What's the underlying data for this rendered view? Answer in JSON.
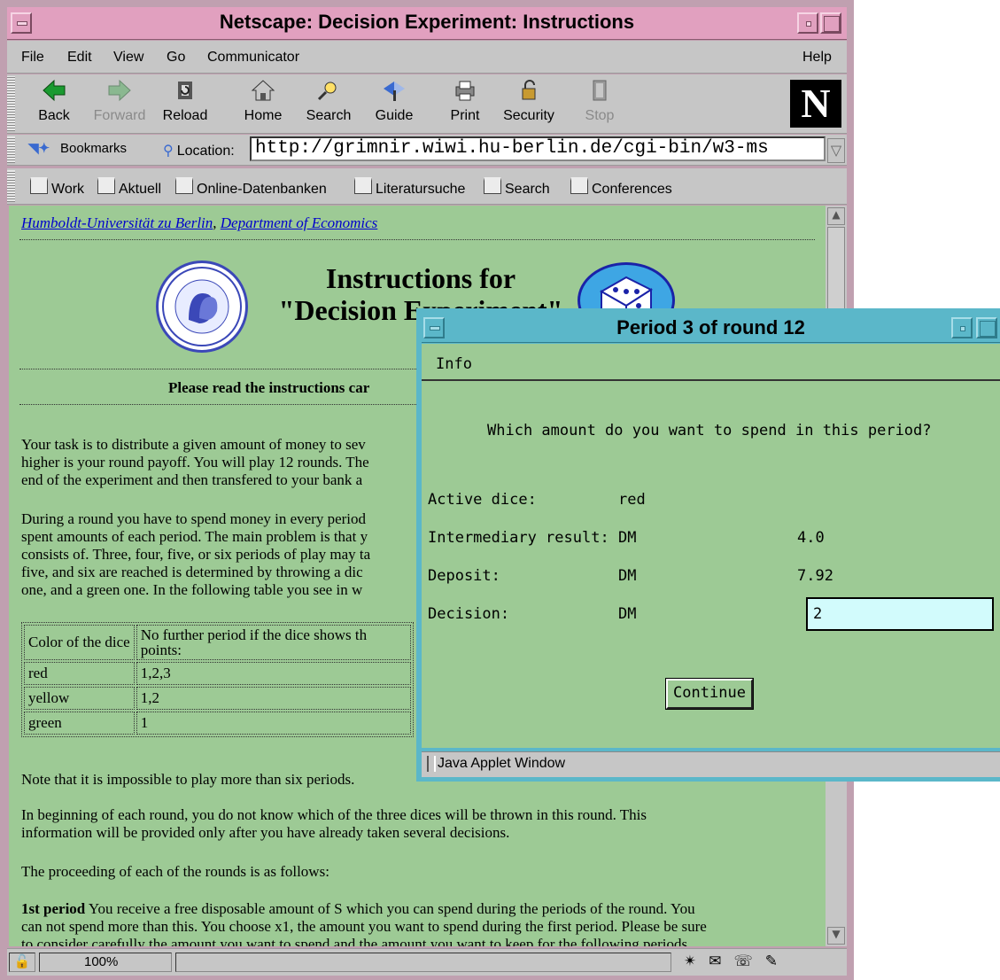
{
  "browser": {
    "title": "Netscape: Decision Experiment: Instructions",
    "menu": [
      "File",
      "Edit",
      "View",
      "Go",
      "Communicator"
    ],
    "help": "Help",
    "toolbar": [
      {
        "label": "Back",
        "icon": "back-arrow-icon",
        "enabled": true
      },
      {
        "label": "Forward",
        "icon": "forward-arrow-icon",
        "enabled": false
      },
      {
        "label": "Reload",
        "icon": "reload-icon",
        "enabled": true
      },
      {
        "label": "Home",
        "icon": "home-icon",
        "enabled": true
      },
      {
        "label": "Search",
        "icon": "search-icon",
        "enabled": true
      },
      {
        "label": "Guide",
        "icon": "guide-icon",
        "enabled": true
      },
      {
        "label": "Print",
        "icon": "print-icon",
        "enabled": true
      },
      {
        "label": "Security",
        "icon": "lock-icon",
        "enabled": true
      },
      {
        "label": "Stop",
        "icon": "stop-icon",
        "enabled": false
      }
    ],
    "logo": "N",
    "bookmarks_label": "Bookmarks",
    "location_label": "Location:",
    "location_url": "http://grimnir.wiwi.hu-berlin.de/cgi-bin/w3-ms",
    "personal_toolbar": [
      "Work",
      "Aktuell",
      "Online-Datenbanken",
      "Literatursuche",
      "Search",
      "Conferences"
    ],
    "zoom": "100%"
  },
  "page": {
    "breadcrumb_1": "Humboldt-Universität zu Berlin",
    "breadcrumb_sep": ",",
    "breadcrumb_2": "Department of Economics",
    "heading_line1": "Instructions for",
    "heading_line2": "\"Decision Experiment\"",
    "read_notice": "Please read the instructions car",
    "p1": [
      "Your task is to distribute a given amount of money to sev",
      "higher is your round payoff. You will play 12 rounds. The",
      "end of the experiment and then transfered to your bank a"
    ],
    "p2": [
      "During a round you have to spend money in every period",
      "spent amounts of each period. The main problem is that y",
      "consists of. Three, four, five, or six periods of play may ta",
      "five, and six are reached is determined by throwing a dic",
      "one, and a green one. In the following table you see in w"
    ],
    "table": {
      "header": [
        "Color of the dice",
        "No further period if the dice shows th points:"
      ],
      "header_col2_line1": "No further period if the dice shows th",
      "header_col2_line2": "points:",
      "rows": [
        [
          "red",
          "1,2,3"
        ],
        [
          "yellow",
          "1,2"
        ],
        [
          "green",
          "1"
        ]
      ]
    },
    "note": "Note that it is impossible to play more than six periods.",
    "p3": [
      "In beginning of each round, you do not know which of the three dices will be thrown in this round. This",
      "information will be provided only after you have already taken several decisions."
    ],
    "p4": "The proceeding of each of the rounds is as follows:",
    "p5_bold": "1st period",
    "p5": [
      " You receive a free disposable amount of S which you can spend during the periods of the round. You",
      "can not spend more than this. You choose x1, the amount you want to spend during the first period. Please be sure",
      "to consider carefully the amount you want to spend and the amount you want to keep for the following periods."
    ]
  },
  "applet": {
    "title": "Period 3 of round 12",
    "menu": "Info",
    "question": "Which amount do you want to spend in this period?",
    "rows": [
      {
        "label": "Active dice:",
        "unit": "red",
        "value": ""
      },
      {
        "label": "Intermediary result:",
        "unit": "DM",
        "value": "4.0"
      },
      {
        "label": "Deposit:",
        "unit": "DM",
        "value": "7.92"
      },
      {
        "label": "Decision:",
        "unit": "DM",
        "value": ""
      }
    ],
    "decision_value": "2",
    "continue_label": "Continue",
    "status": "Java Applet Window"
  }
}
